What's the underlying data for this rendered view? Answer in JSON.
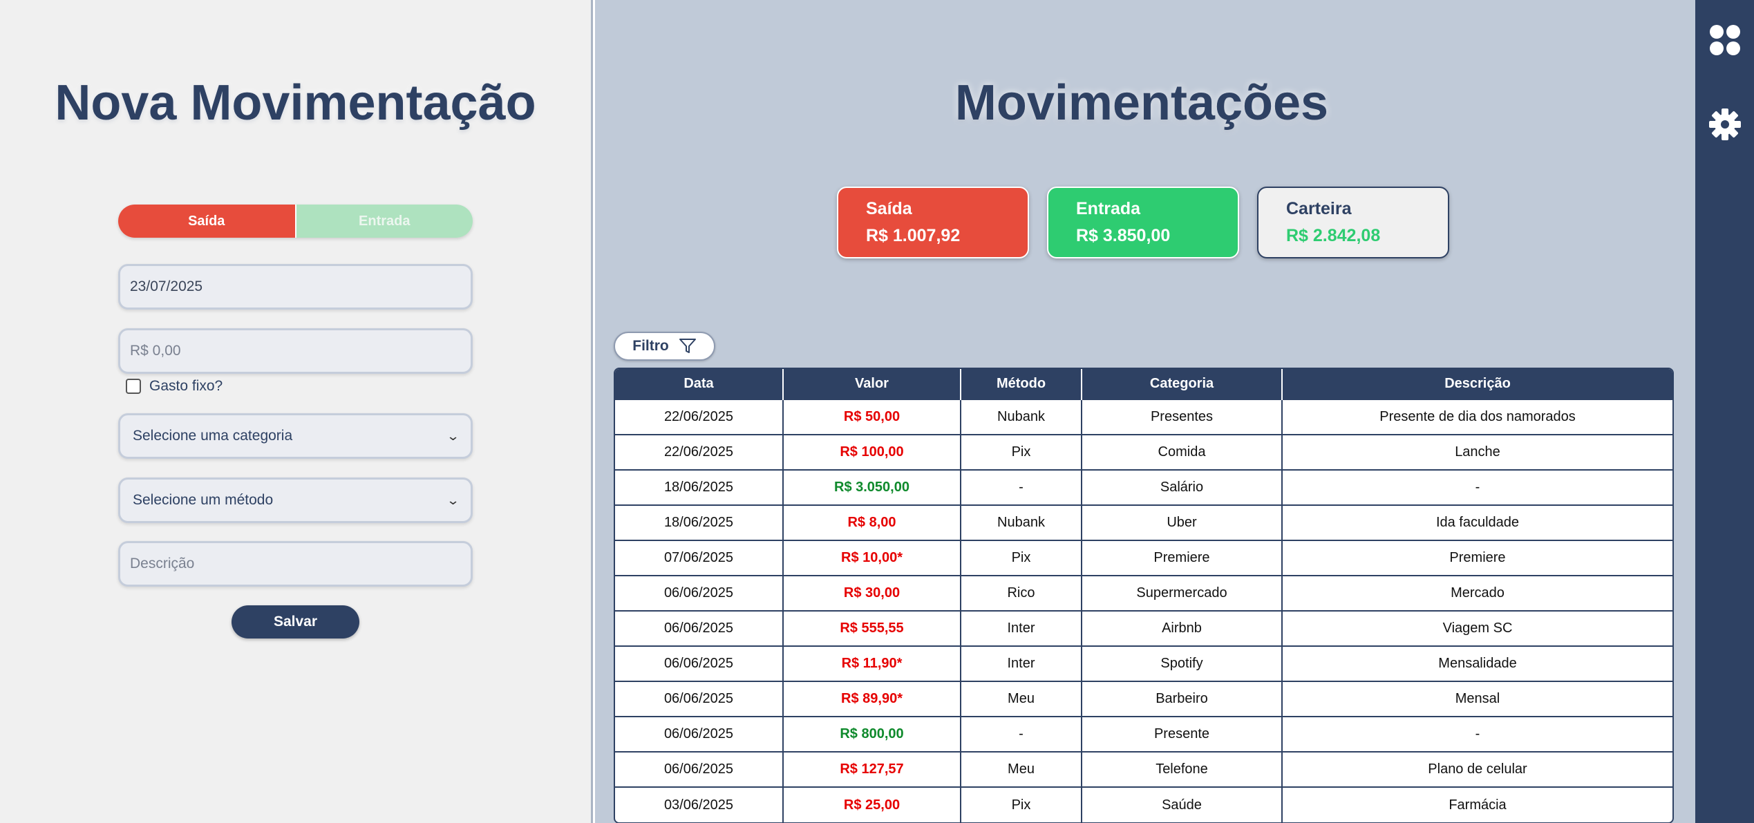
{
  "form": {
    "title": "Nova Movimentação",
    "toggle": {
      "out_label": "Saída",
      "in_label": "Entrada",
      "selected": "Saída"
    },
    "date_value": "23/07/2025",
    "amount_placeholder": "R$ 0,00",
    "fixed_label": "Gasto fixo?",
    "category_select": "Selecione uma categoria",
    "method_select": "Selecione um método",
    "description_placeholder": "Descrição",
    "save_label": "Salvar"
  },
  "main": {
    "title": "Movimentações",
    "cards": {
      "out": {
        "label": "Saída",
        "value": "R$ 1.007,92"
      },
      "in": {
        "label": "Entrada",
        "value": "R$ 3.850,00"
      },
      "wallet": {
        "label": "Carteira",
        "value": "R$ 2.842,08"
      }
    },
    "filter_label": "Filtro",
    "table": {
      "headers": [
        "Data",
        "Valor",
        "Método",
        "Categoria",
        "Descrição"
      ],
      "rows": [
        {
          "data": "22/06/2025",
          "valor": "R$ 50,00",
          "type": "neg",
          "metodo": "Nubank",
          "categoria": "Presentes",
          "descricao": "Presente de dia dos namorados"
        },
        {
          "data": "22/06/2025",
          "valor": "R$ 100,00",
          "type": "neg",
          "metodo": "Pix",
          "categoria": "Comida",
          "descricao": "Lanche"
        },
        {
          "data": "18/06/2025",
          "valor": "R$ 3.050,00",
          "type": "pos",
          "metodo": "-",
          "categoria": "Salário",
          "descricao": "-"
        },
        {
          "data": "18/06/2025",
          "valor": "R$ 8,00",
          "type": "neg",
          "metodo": "Nubank",
          "categoria": "Uber",
          "descricao": "Ida faculdade"
        },
        {
          "data": "07/06/2025",
          "valor": "R$ 10,00*",
          "type": "neg",
          "metodo": "Pix",
          "categoria": "Premiere",
          "descricao": "Premiere"
        },
        {
          "data": "06/06/2025",
          "valor": "R$ 30,00",
          "type": "neg",
          "metodo": "Rico",
          "categoria": "Supermercado",
          "descricao": "Mercado"
        },
        {
          "data": "06/06/2025",
          "valor": "R$ 555,55",
          "type": "neg",
          "metodo": "Inter",
          "categoria": "Airbnb",
          "descricao": "Viagem SC"
        },
        {
          "data": "06/06/2025",
          "valor": "R$ 11,90*",
          "type": "neg",
          "metodo": "Inter",
          "categoria": "Spotify",
          "descricao": "Mensalidade"
        },
        {
          "data": "06/06/2025",
          "valor": "R$ 89,90*",
          "type": "neg",
          "metodo": "Meu",
          "categoria": "Barbeiro",
          "descricao": "Mensal"
        },
        {
          "data": "06/06/2025",
          "valor": "R$ 800,00",
          "type": "pos",
          "metodo": "-",
          "categoria": "Presente",
          "descricao": "-"
        },
        {
          "data": "06/06/2025",
          "valor": "R$ 127,57",
          "type": "neg",
          "metodo": "Meu",
          "categoria": "Telefone",
          "descricao": "Plano de celular"
        },
        {
          "data": "03/06/2025",
          "valor": "R$ 25,00",
          "type": "neg",
          "metodo": "Pix",
          "categoria": "Saúde",
          "descricao": "Farmácia"
        }
      ]
    }
  },
  "rail": {
    "icons": [
      "grid-icon",
      "gear-icon"
    ]
  },
  "colors": {
    "primary": "#2e4163",
    "out": "#e74c3c",
    "in": "#2ecc71",
    "negative_text": "#e60000",
    "positive_text": "#0f8a2c"
  }
}
